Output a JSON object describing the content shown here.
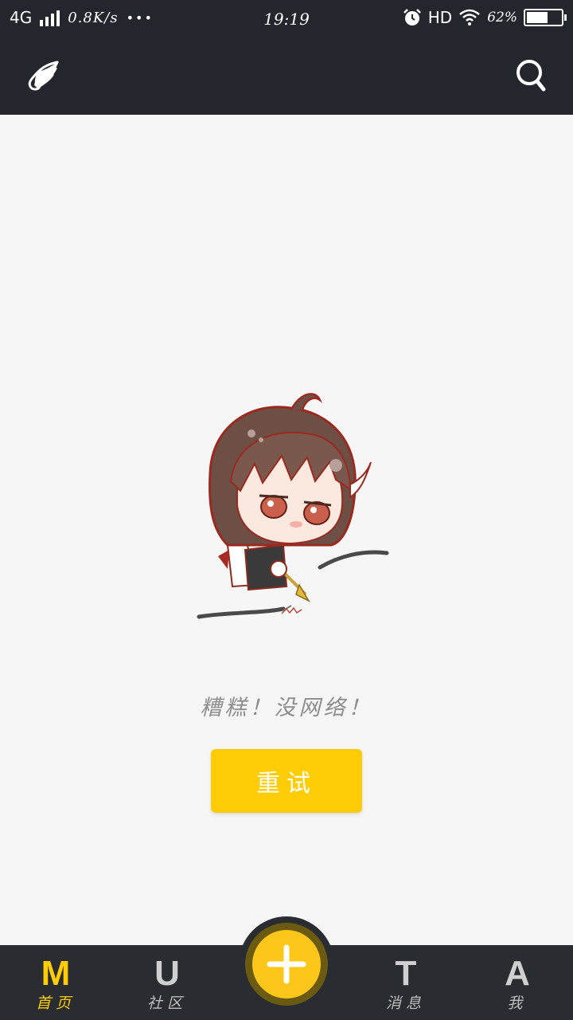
{
  "status_bar": {
    "network": "4G",
    "speed": "0.8K/s",
    "more": "•••",
    "time": "19:19",
    "hd": "HD",
    "battery_text": "62%",
    "battery_level": 0.62
  },
  "top_bar": {
    "logo_icon": "wing-icon",
    "search_icon": "search-icon"
  },
  "error": {
    "message": "糟糕！没网络！",
    "retry_label": "重试"
  },
  "tabs": [
    {
      "glyph": "M",
      "label": "首页",
      "active": true
    },
    {
      "glyph": "U",
      "label": "社区",
      "active": false
    },
    {
      "glyph": "T",
      "label": "消息",
      "active": false
    },
    {
      "glyph": "A",
      "label": "我",
      "active": false
    }
  ],
  "fab": {
    "icon": "plus-icon"
  },
  "colors": {
    "bar_bg": "#23262c",
    "tabbar_bg": "#292c31",
    "accent": "#ffcd08",
    "inactive": "#bdbdbd"
  }
}
